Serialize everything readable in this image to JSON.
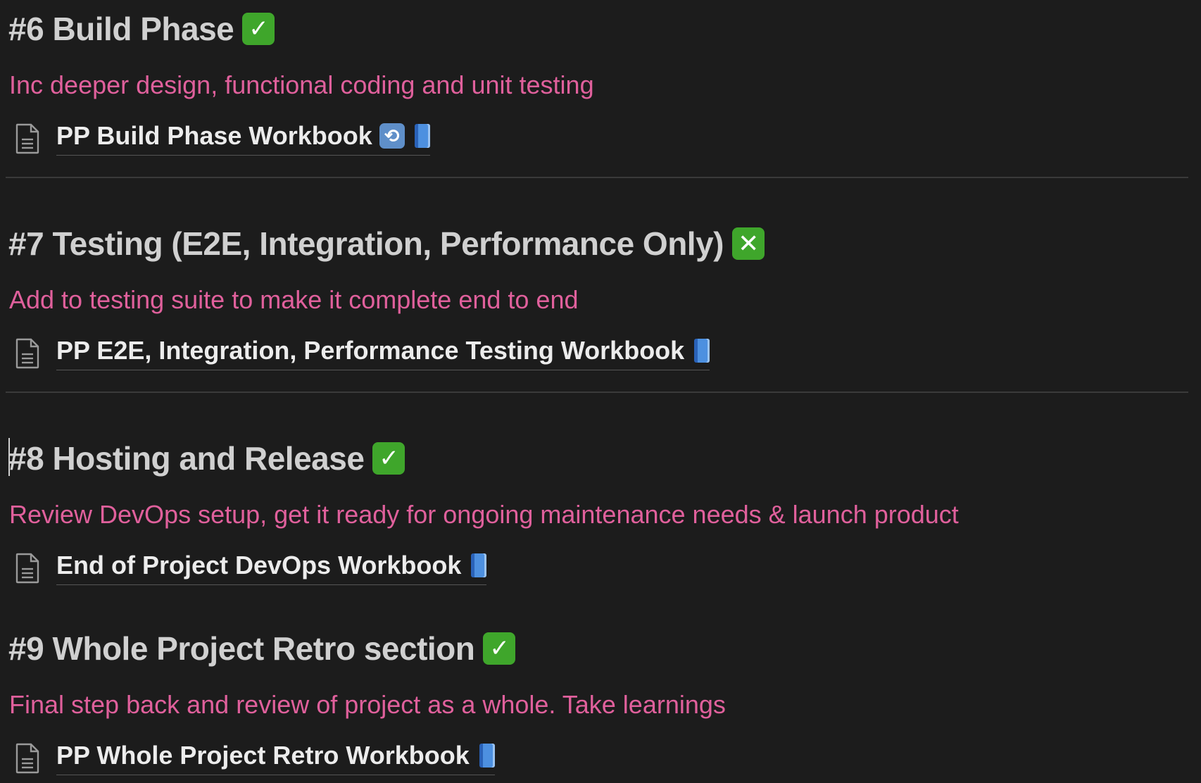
{
  "sections": [
    {
      "heading": "#6 Build Phase",
      "status_icon": "check-mark-icon",
      "status_glyph": "✓",
      "description": "Inc deeper design, functional coding and unit testing",
      "page_link": "PP Build Phase Workbook",
      "page_emojis": [
        "repeat-icon",
        "blue-book-icon"
      ]
    },
    {
      "heading": "#7 Testing (E2E, Integration, Performance Only)",
      "status_icon": "cross-mark-icon",
      "status_glyph": "✕",
      "description": "Add to testing suite to make it complete end to end",
      "page_link": "PP E2E, Integration, Performance Testing Workbook",
      "page_emojis": [
        "blue-book-icon"
      ]
    },
    {
      "heading": "#8 Hosting and Release",
      "status_icon": "check-mark-icon",
      "status_glyph": "✓",
      "description": "Review DevOps setup, get it ready for ongoing maintenance needs & launch product",
      "page_link": "End of Project DevOps Workbook",
      "page_emojis": [
        "blue-book-icon"
      ]
    },
    {
      "heading": "#9 Whole Project Retro section",
      "status_icon": "check-mark-icon",
      "status_glyph": "✓",
      "description": "Final step back and review of project as a whole. Take learnings",
      "page_link": "PP Whole Project Retro Workbook",
      "page_emojis": [
        "blue-book-icon"
      ]
    }
  ],
  "colors": {
    "background": "#1c1c1c",
    "heading": "#d0d0d0",
    "description": "#e0609c",
    "link": "#ececec",
    "status_green": "#3fa62b"
  }
}
